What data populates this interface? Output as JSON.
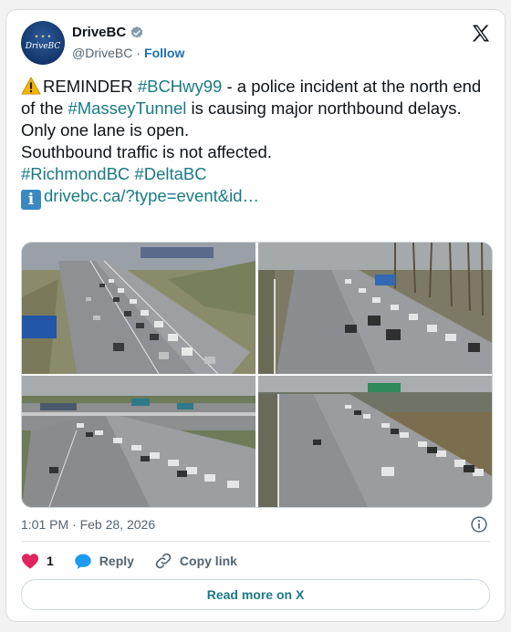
{
  "account": {
    "name": "DriveBC",
    "handle": "@DriveBC",
    "separator": "·",
    "follow_label": "Follow",
    "avatar_brand": "DriveBC"
  },
  "tweet": {
    "line1_prefix": "REMINDER ",
    "tag_hwy": "#BCHwy99",
    "line1_suffix": " - a police incident at the north end of the ",
    "tag_tunnel": "#MasseyTunnel",
    "line1_end": " is causing major northbound delays.",
    "line2": "Only one lane is open.",
    "line3": "Southbound traffic is not affected.",
    "tag_richmond": "#RichmondBC",
    "tag_delta": "#DeltaBC",
    "link": "drivebc.ca/?type=event&id…"
  },
  "meta": {
    "time": "1:01 PM",
    "separator": "·",
    "date": "Feb 28, 2026"
  },
  "actions": {
    "like_count": "1",
    "reply_label": "Reply",
    "copy_label": "Copy link",
    "read_more_label": "Read more on X"
  },
  "colors": {
    "hashtag": "#1a7a85",
    "heart": "#e0245e",
    "reply": "#1d9bf0"
  }
}
